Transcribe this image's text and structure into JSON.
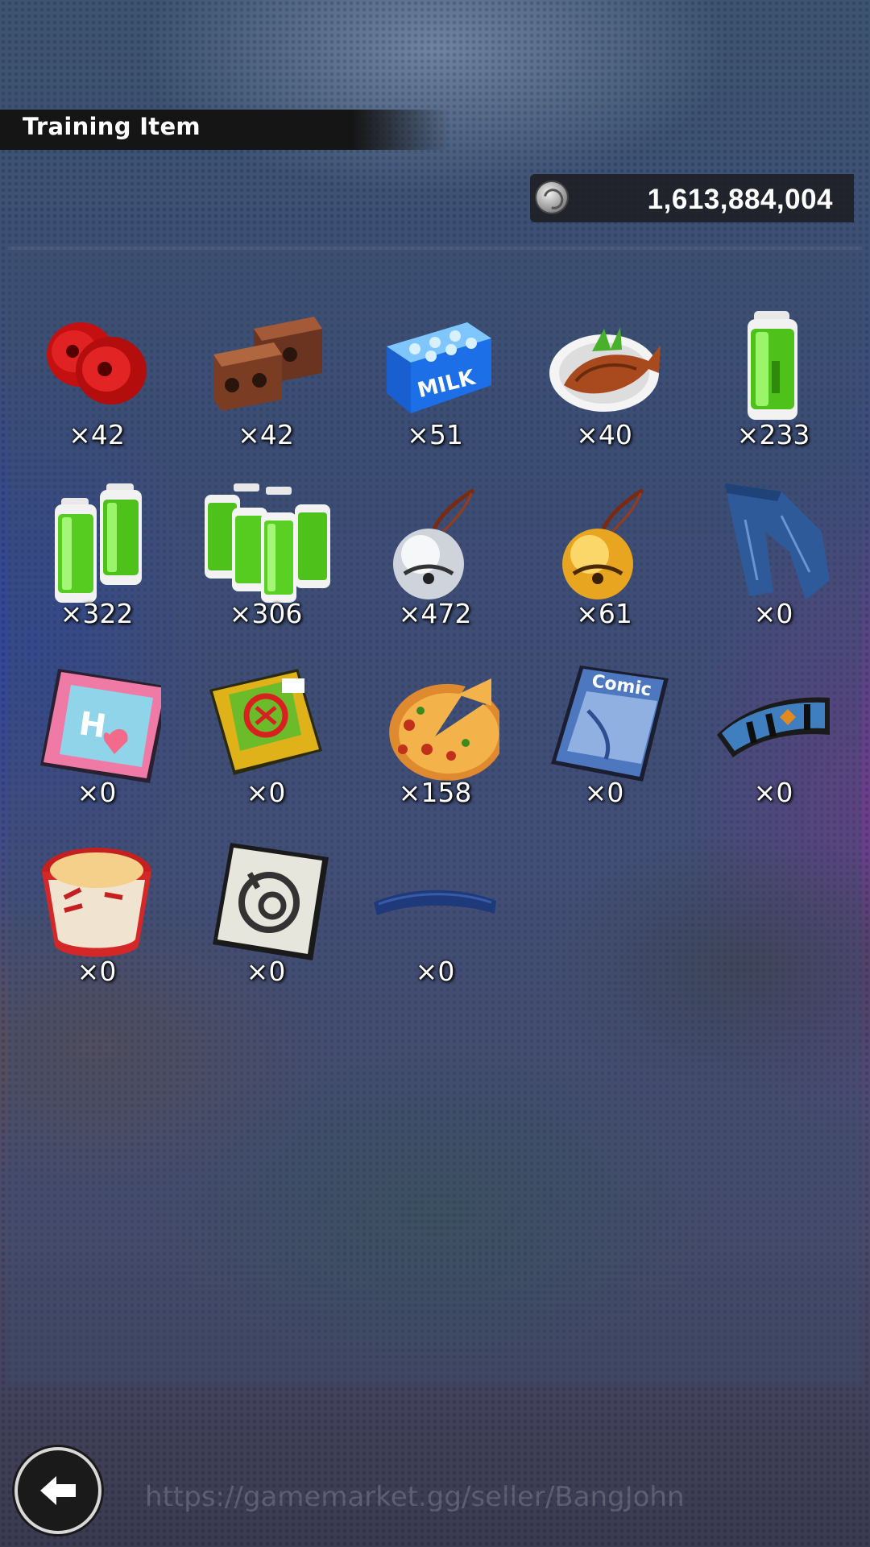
{
  "header": {
    "title": "Training Item"
  },
  "currency": {
    "icon": "coin-icon",
    "value": "1,613,884,004"
  },
  "items": [
    {
      "name": "red-weights",
      "icon": "red-weights-icon",
      "count": "×42"
    },
    {
      "name": "brick-weights",
      "icon": "brick-weights-icon",
      "count": "×42"
    },
    {
      "name": "milk",
      "icon": "milk-carton-icon",
      "count": "×51",
      "label": "MILK"
    },
    {
      "name": "grilled-fish",
      "icon": "grilled-fish-icon",
      "count": "×40"
    },
    {
      "name": "battery",
      "icon": "battery-icon",
      "count": "×233"
    },
    {
      "name": "battery-pair",
      "icon": "battery-pair-icon",
      "count": "×322"
    },
    {
      "name": "battery-pack",
      "icon": "battery-pack-icon",
      "count": "×306"
    },
    {
      "name": "silver-bell",
      "icon": "silver-bell-icon",
      "count": "×472"
    },
    {
      "name": "gold-bell",
      "icon": "gold-bell-icon",
      "count": "×61"
    },
    {
      "name": "jeans",
      "icon": "jeans-icon",
      "count": "×0"
    },
    {
      "name": "pink-magazine",
      "icon": "magazine-icon",
      "count": "×0"
    },
    {
      "name": "joke-book",
      "icon": "book-icon",
      "count": "×0"
    },
    {
      "name": "pizza",
      "icon": "pizza-icon",
      "count": "×158"
    },
    {
      "name": "comic",
      "icon": "comic-book-icon",
      "count": "×0",
      "label": "Comic"
    },
    {
      "name": "wristband",
      "icon": "wristband-icon",
      "count": "×0"
    },
    {
      "name": "cup-noodles",
      "icon": "cup-noodle-icon",
      "count": "×0"
    },
    {
      "name": "capsule-card",
      "icon": "capsule-card-icon",
      "count": "×0"
    },
    {
      "name": "blue-band",
      "icon": "blue-band-icon",
      "count": "×0"
    }
  ],
  "watermark": "https://gamemarket.gg/seller/BangJohn",
  "back_button": {
    "icon": "back-arrow-icon"
  }
}
